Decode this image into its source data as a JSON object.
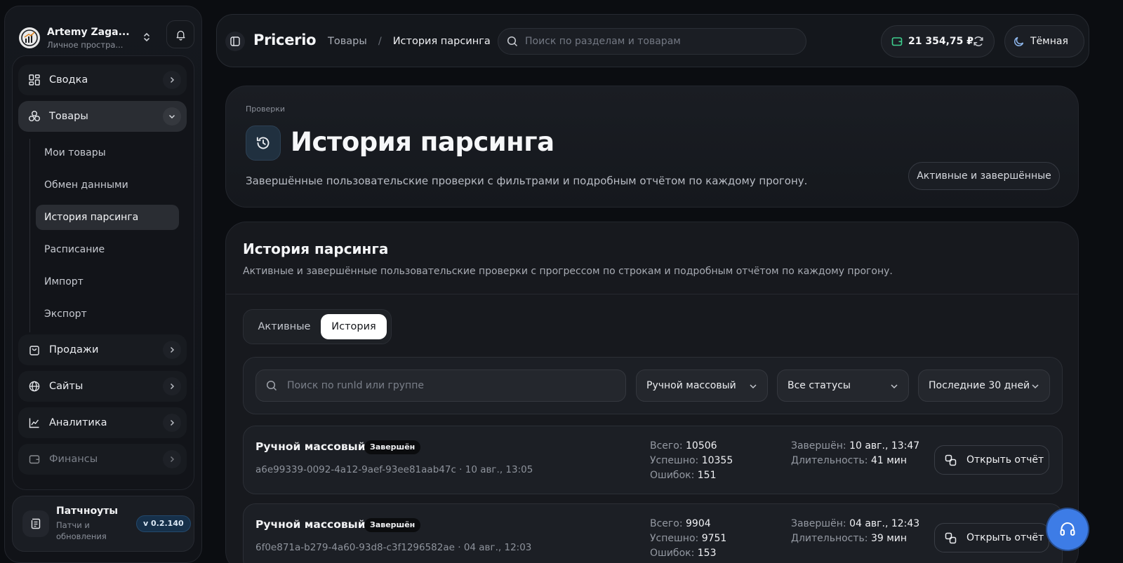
{
  "workspace": {
    "name": "Artemy Zaga...",
    "subtitle": "Личное простра..."
  },
  "sidebar": {
    "items": [
      {
        "label": "Сводка",
        "icon": "dashboard-icon"
      },
      {
        "label": "Товары",
        "icon": "products-icon",
        "expanded": true
      },
      {
        "label": "Продажи",
        "icon": "shopping-bag-icon"
      },
      {
        "label": "Сайты",
        "icon": "globe-icon"
      },
      {
        "label": "Аналитика",
        "icon": "chart-icon"
      },
      {
        "label": "Финансы",
        "icon": "wallet-icon",
        "dimmed": true
      }
    ],
    "subitems": [
      "Мои товары",
      "Обмен данными",
      "История парсинга",
      "Расписание",
      "Импорт",
      "Экспорт"
    ],
    "active_subitem": "История парсинга"
  },
  "patchnotes": {
    "title": "Патчноуты",
    "subtitle": "Патчи и обновления",
    "version": "v 0.2.140"
  },
  "topbar": {
    "brand": "Pricerio",
    "breadcrumb": {
      "parent": "Товары",
      "separator": "/",
      "current": "История парсинга"
    },
    "search_placeholder": "Поиск по разделам и товарам",
    "balance": "21 354,75 ₽",
    "theme_label": "Тёмная"
  },
  "hero": {
    "eyebrow": "Проверки",
    "title": "История парсинга",
    "description": "Завершённые пользовательские проверки с фильтрами и подробным отчётом по каждому прогону.",
    "pill": "Активные и завершённые"
  },
  "history": {
    "title": "История парсинга",
    "subtitle": "Активные и завершённые пользовательские проверки с прогрессом по строкам и подробным отчётом по каждому прогону.",
    "tabs": {
      "active": "Активные",
      "history": "История"
    },
    "filters": {
      "search_placeholder": "Поиск по runId или группе",
      "type": "Ручной массовый",
      "status": "Все статусы",
      "period": "Последние 30 дней"
    },
    "labels": {
      "total": "Всего:",
      "success": "Успешно:",
      "errors": "Ошибок:",
      "finished": "Завершён:",
      "duration": "Длительность:",
      "open_report": "Открыть отчёт"
    },
    "runs": [
      {
        "name": "Ручной массовый",
        "badge": "Завершён",
        "meta": "a6e99339-0092-4a12-9aef-93ee81aab47c · 10 авг., 13:05",
        "total": "10506",
        "success": "10355",
        "errors": "151",
        "finished": "10 авг., 13:47",
        "duration": "41 мин"
      },
      {
        "name": "Ручной массовый",
        "badge": "Завершён",
        "meta": "6f0e871a-b279-4a60-93d8-c3f1296582ae · 04 авг., 12:03",
        "total": "9904",
        "success": "9751",
        "errors": "153",
        "finished": "04 авг., 12:43",
        "duration": "39 мин"
      }
    ]
  },
  "colors": {
    "accent": "#3d7ce6",
    "background": "#0b0d11",
    "wallet": "#3ecf8e"
  }
}
